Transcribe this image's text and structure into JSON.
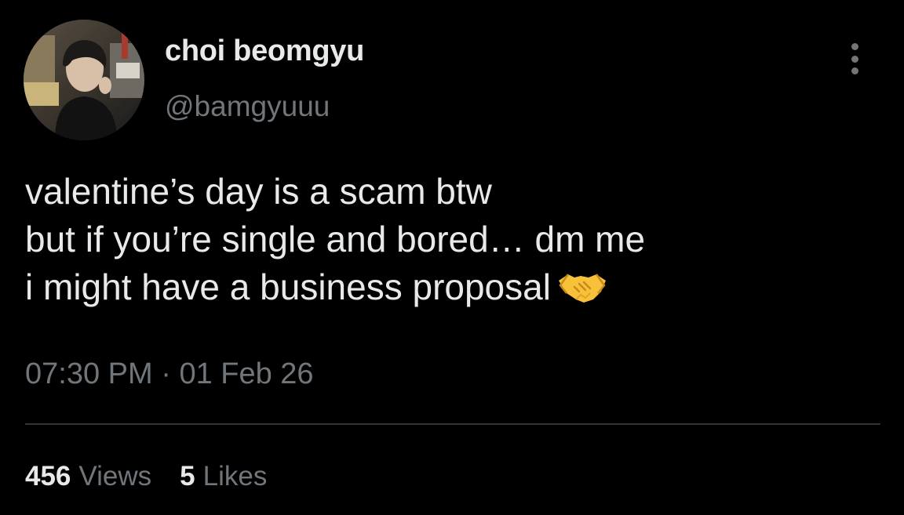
{
  "user": {
    "display_name": "choi beomgyu",
    "handle": "@bamgyuuu",
    "avatar_icon": "profile-photo"
  },
  "tweet": {
    "lines": [
      "valentine’s day is a scam btw",
      "but if you’re single and bored… dm me",
      "i might have a business proposal"
    ],
    "emoji": "handshake-icon",
    "time": "07:30 PM",
    "separator": "·",
    "date": "01 Feb 26"
  },
  "stats": {
    "views_count": "456",
    "views_label": "Views",
    "likes_count": "5",
    "likes_label": "Likes"
  },
  "colors": {
    "background": "#000000",
    "text_primary": "#e7e9ea",
    "text_secondary": "#71767b",
    "divider": "#2f3336",
    "emoji": "#f7c23a"
  },
  "icons": {
    "more": "more-vertical-icon"
  }
}
